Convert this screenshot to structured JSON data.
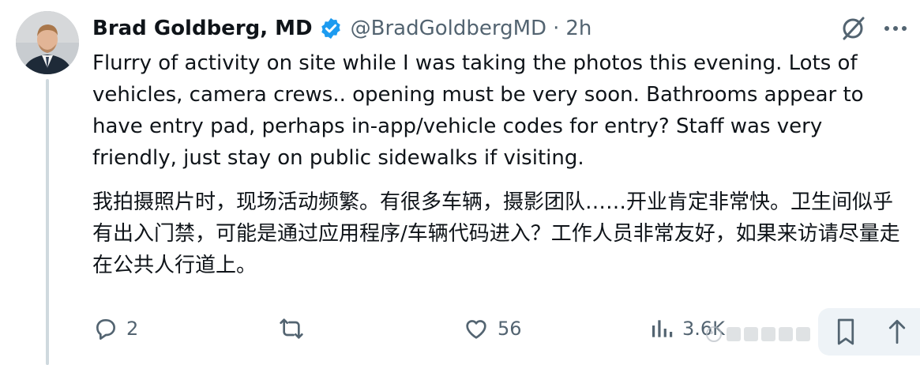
{
  "author": {
    "name": "Brad Goldberg, MD",
    "handle": "@BradGoldbergMD",
    "separator": "·",
    "time": "2h"
  },
  "post": {
    "text_en": "Flurry of activity on site while I was taking the photos this evening. Lots of vehicles, camera crews.. opening must be very soon. Bathrooms appear to have entry pad, perhaps in-app/vehicle codes for entry? Staff was very friendly, just stay on public sidewalks if visiting.",
    "text_zh": "我拍摄照片时，现场活动频繁。有很多车辆，摄影团队……开业肯定非常快。卫生间似乎有出入门禁，可能是通过应用程序/车辆代码进入？工作人员非常友好，如果来访请尽量走在公共人行道上。"
  },
  "actions": {
    "reply_count": "2",
    "repost_count": "",
    "like_count": "56",
    "views_count": "3.6K"
  },
  "colors": {
    "text": "#0f1419",
    "secondary": "#536471",
    "verified_blue": "#1d9bf0",
    "thread_line": "#cfd9de",
    "pill_bg": "#eef3f7"
  },
  "icons": [
    "verified-badge-icon",
    "grok-icon",
    "more-icon",
    "reply-icon",
    "repost-icon",
    "like-icon",
    "views-icon",
    "bookmark-icon",
    "share-icon"
  ]
}
